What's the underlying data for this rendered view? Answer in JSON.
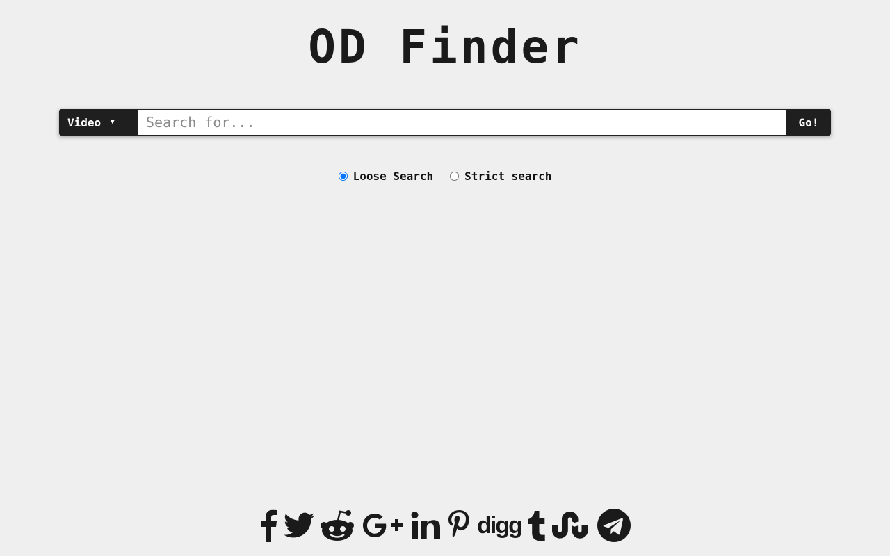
{
  "app": {
    "title": "OD Finder"
  },
  "search": {
    "type_label": "Video",
    "placeholder": "Search for...",
    "value": "",
    "go_label": "Go!"
  },
  "search_modes": [
    {
      "label": "Loose Search",
      "checked": true
    },
    {
      "label": "Strict search",
      "checked": false
    }
  ],
  "share": {
    "digg_label": "digg",
    "icons": [
      "facebook-icon",
      "twitter-icon",
      "reddit-icon",
      "google-plus-icon",
      "linkedin-icon",
      "pinterest-icon",
      "digg-icon",
      "tumblr-icon",
      "stumbleupon-icon",
      "telegram-icon"
    ]
  },
  "colors": {
    "background": "#efefef",
    "dark": "#1f1f1f",
    "radio_accent": "#1a73e8"
  }
}
